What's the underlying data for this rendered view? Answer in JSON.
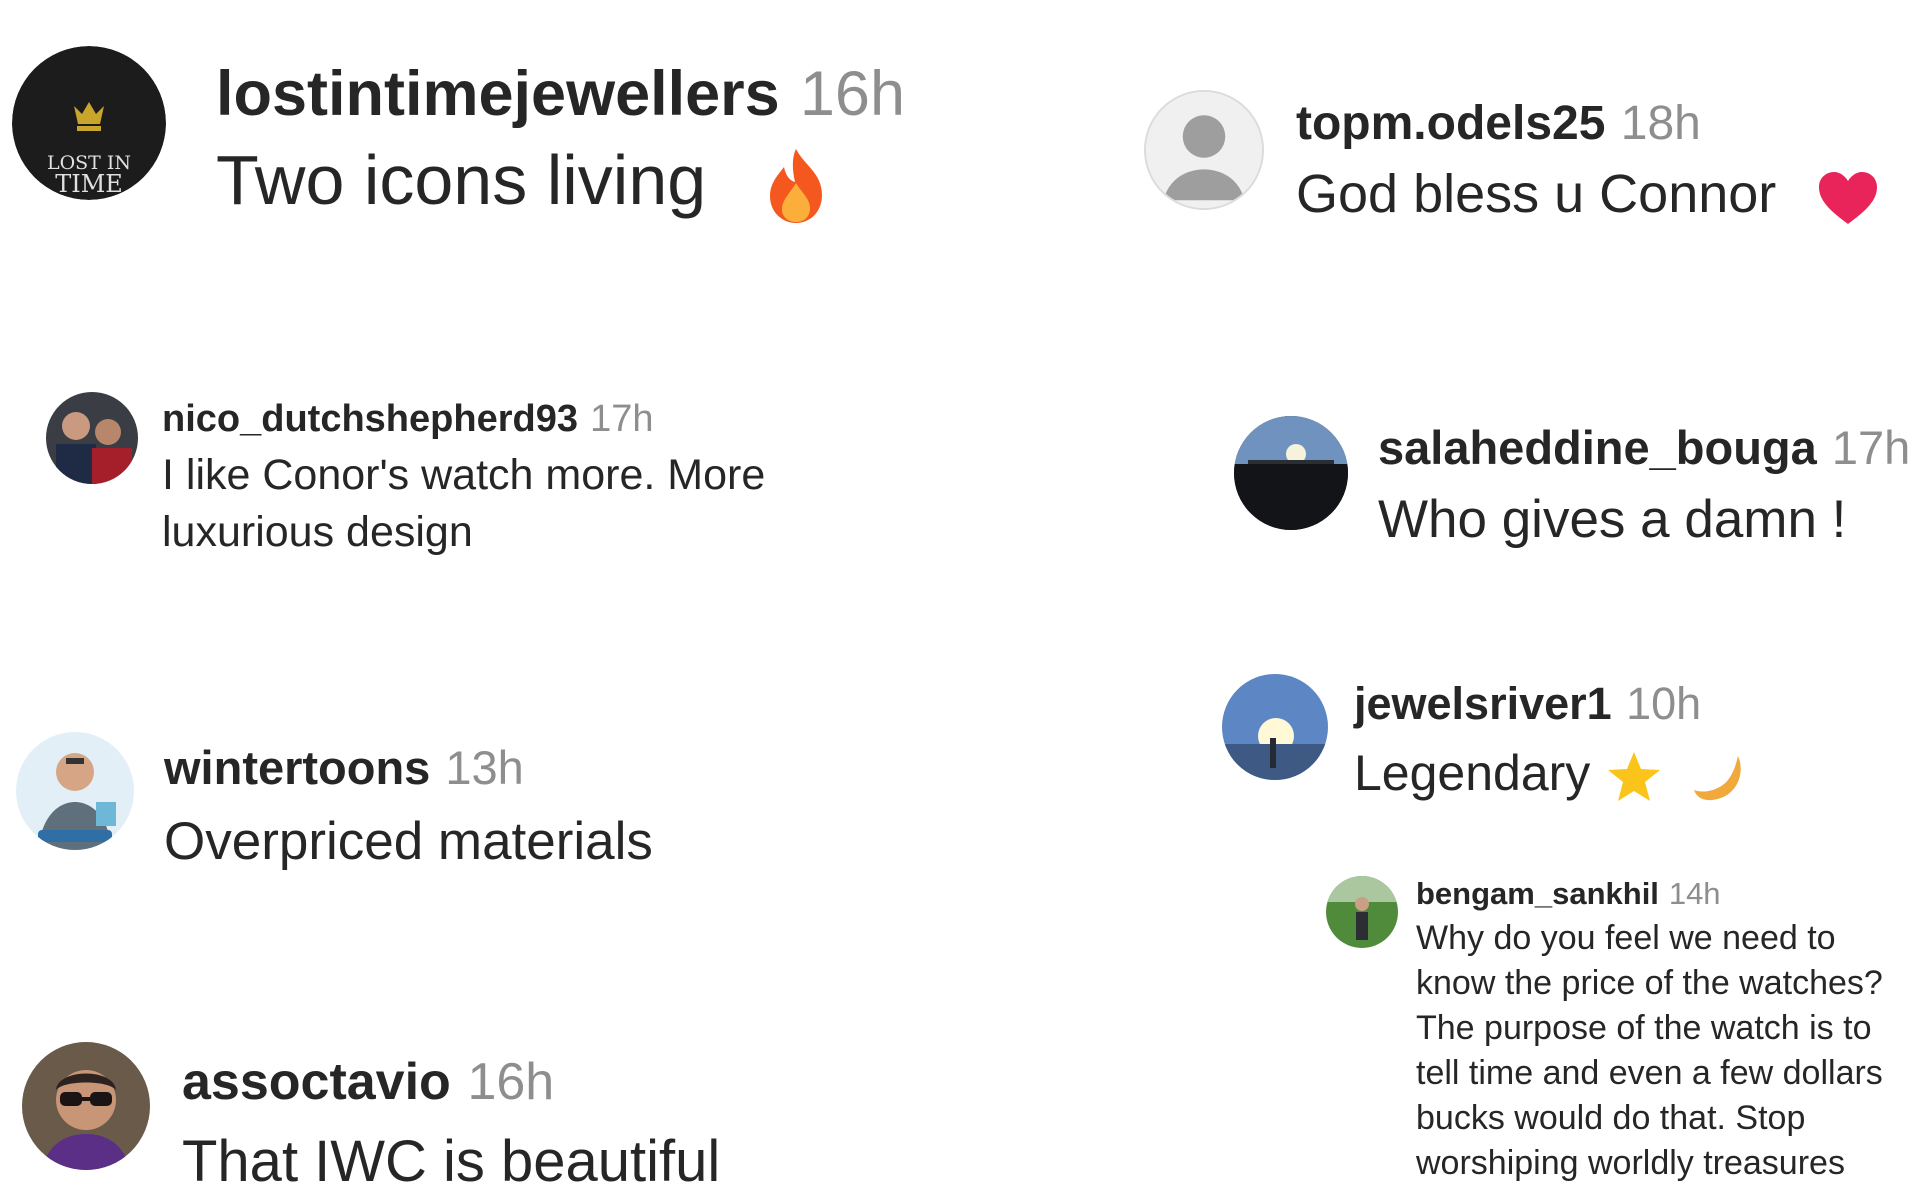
{
  "comments": [
    {
      "username": "lostintimejewellers",
      "time": "16h",
      "text": "Two icons living",
      "emoji": "fire-icon",
      "avatar_text": [
        "LOST IN",
        "TIME"
      ]
    },
    {
      "username": "topm.odels25",
      "time": "18h",
      "text": "God bless u Connor",
      "emoji": "heart-icon"
    },
    {
      "username": "nico_dutchshepherd93",
      "time": "17h",
      "text_lines": [
        "I like Conor's watch more. More",
        "luxurious design"
      ]
    },
    {
      "username": "salaheddine_bouga",
      "time": "17h",
      "text": "Who gives a damn !"
    },
    {
      "username": "wintertoons",
      "time": "13h",
      "text": "Overpriced materials"
    },
    {
      "username": "jewelsriver1",
      "time": "10h",
      "text": "Legendary",
      "emojis": [
        "star-icon",
        "crescent-moon-icon"
      ]
    },
    {
      "username": "bengam_sankhil",
      "time": "14h",
      "text_lines": [
        "Why do you feel we need to",
        "know the price of the watches?",
        "The purpose of the watch is to",
        "tell time and even a few dollars",
        "bucks would do that. Stop",
        "worshiping worldly treasures"
      ]
    },
    {
      "username": "assoctavio",
      "time": "16h",
      "text": "That IWC is beautiful"
    }
  ],
  "colors": {
    "text": "#262626",
    "timestamp": "#8e8e8e",
    "fire": "#f4581f",
    "heart": "#e8245a",
    "star": "#fbc41a",
    "moon": "#f2a93b"
  }
}
